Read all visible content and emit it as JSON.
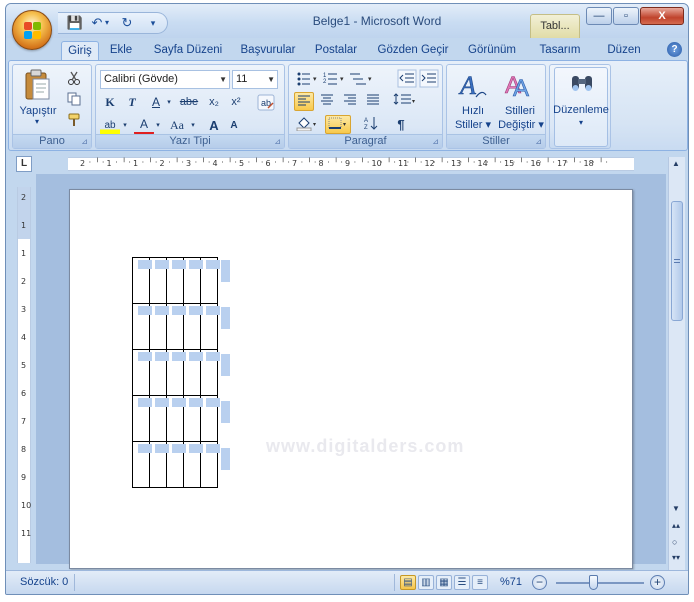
{
  "window": {
    "title": "Belge1 - Microsoft Word",
    "context_tab": "Tabl...",
    "controls": {
      "minimize": "—",
      "maximize": "▫",
      "close": "X"
    }
  },
  "quick_access": {
    "save": "💾",
    "undo": "↶",
    "undo_dd": "▾",
    "redo": "↻",
    "customize": "▾"
  },
  "tabs": [
    {
      "label": "Giriş",
      "active": true
    },
    {
      "label": "Ekle"
    },
    {
      "label": "Sayfa Düzeni"
    },
    {
      "label": "Başvurular"
    },
    {
      "label": "Postalar"
    },
    {
      "label": "Gözden Geçir"
    },
    {
      "label": "Görünüm"
    },
    {
      "label": "Tasarım"
    },
    {
      "label": "Düzen"
    }
  ],
  "help": "?",
  "ribbon": {
    "clipboard": {
      "label": "Pano",
      "paste": "Yapıştır",
      "paste_dd": "▾"
    },
    "font": {
      "label": "Yazı Tipi",
      "font_name": "Calibri (Gövde)",
      "font_size": "11",
      "bold": "K",
      "italic": "T",
      "underline": "A",
      "strikethrough": "abe",
      "subscript": "x₂",
      "superscript": "x²",
      "change_case": "Aa",
      "grow": "A",
      "shrink": "A",
      "highlight": "ab",
      "font_color": "A"
    },
    "paragraph": {
      "label": "Paragraf",
      "show_marks": "¶"
    },
    "styles": {
      "label": "Stiller",
      "quick_styles_1": "Hızlı",
      "quick_styles_2": "Stiller",
      "change_styles_1": "Stilleri",
      "change_styles_2": "Değiştir"
    },
    "editing": {
      "label": "Düzenleme"
    }
  },
  "ruler": {
    "corner": "L",
    "horizontal": [
      "2",
      "1",
      "1",
      "2",
      "3",
      "4",
      "5",
      "6",
      "7",
      "8",
      "9",
      "10",
      "11",
      "12",
      "13",
      "14",
      "15",
      "16",
      "17",
      "18"
    ],
    "vertical": [
      "2",
      "1",
      "1",
      "2",
      "3",
      "4",
      "5",
      "6",
      "7",
      "8",
      "9",
      "10",
      "11"
    ]
  },
  "document": {
    "watermark": "www.digitalders.com",
    "table": {
      "rows": 5,
      "cols": 5
    }
  },
  "status": {
    "word_count": "Sözcük: 0",
    "zoom": "%71",
    "zoom_fraction": 0.42
  },
  "colors": {
    "ribbon_bg": "#dbe7f6",
    "frame": "#c2d7ee",
    "selection": "#b9d0ef",
    "active_view": "#f5c54a"
  }
}
